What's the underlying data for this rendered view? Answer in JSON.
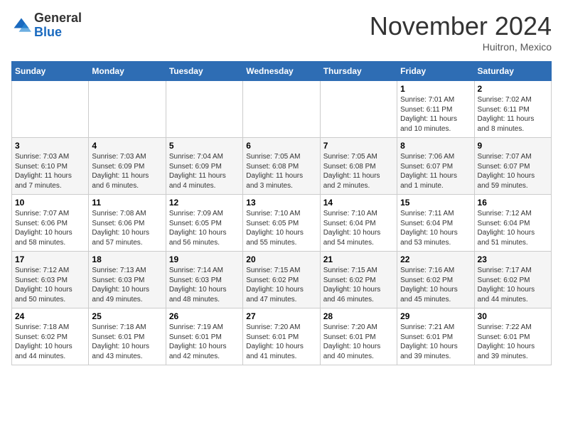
{
  "header": {
    "logo_line1": "General",
    "logo_line2": "Blue",
    "month_title": "November 2024",
    "location": "Huitron, Mexico"
  },
  "days_of_week": [
    "Sunday",
    "Monday",
    "Tuesday",
    "Wednesday",
    "Thursday",
    "Friday",
    "Saturday"
  ],
  "weeks": [
    [
      {
        "day": "",
        "info": ""
      },
      {
        "day": "",
        "info": ""
      },
      {
        "day": "",
        "info": ""
      },
      {
        "day": "",
        "info": ""
      },
      {
        "day": "",
        "info": ""
      },
      {
        "day": "1",
        "info": "Sunrise: 7:01 AM\nSunset: 6:11 PM\nDaylight: 11 hours\nand 10 minutes."
      },
      {
        "day": "2",
        "info": "Sunrise: 7:02 AM\nSunset: 6:11 PM\nDaylight: 11 hours\nand 8 minutes."
      }
    ],
    [
      {
        "day": "3",
        "info": "Sunrise: 7:03 AM\nSunset: 6:10 PM\nDaylight: 11 hours\nand 7 minutes."
      },
      {
        "day": "4",
        "info": "Sunrise: 7:03 AM\nSunset: 6:09 PM\nDaylight: 11 hours\nand 6 minutes."
      },
      {
        "day": "5",
        "info": "Sunrise: 7:04 AM\nSunset: 6:09 PM\nDaylight: 11 hours\nand 4 minutes."
      },
      {
        "day": "6",
        "info": "Sunrise: 7:05 AM\nSunset: 6:08 PM\nDaylight: 11 hours\nand 3 minutes."
      },
      {
        "day": "7",
        "info": "Sunrise: 7:05 AM\nSunset: 6:08 PM\nDaylight: 11 hours\nand 2 minutes."
      },
      {
        "day": "8",
        "info": "Sunrise: 7:06 AM\nSunset: 6:07 PM\nDaylight: 11 hours\nand 1 minute."
      },
      {
        "day": "9",
        "info": "Sunrise: 7:07 AM\nSunset: 6:07 PM\nDaylight: 10 hours\nand 59 minutes."
      }
    ],
    [
      {
        "day": "10",
        "info": "Sunrise: 7:07 AM\nSunset: 6:06 PM\nDaylight: 10 hours\nand 58 minutes."
      },
      {
        "day": "11",
        "info": "Sunrise: 7:08 AM\nSunset: 6:06 PM\nDaylight: 10 hours\nand 57 minutes."
      },
      {
        "day": "12",
        "info": "Sunrise: 7:09 AM\nSunset: 6:05 PM\nDaylight: 10 hours\nand 56 minutes."
      },
      {
        "day": "13",
        "info": "Sunrise: 7:10 AM\nSunset: 6:05 PM\nDaylight: 10 hours\nand 55 minutes."
      },
      {
        "day": "14",
        "info": "Sunrise: 7:10 AM\nSunset: 6:04 PM\nDaylight: 10 hours\nand 54 minutes."
      },
      {
        "day": "15",
        "info": "Sunrise: 7:11 AM\nSunset: 6:04 PM\nDaylight: 10 hours\nand 53 minutes."
      },
      {
        "day": "16",
        "info": "Sunrise: 7:12 AM\nSunset: 6:04 PM\nDaylight: 10 hours\nand 51 minutes."
      }
    ],
    [
      {
        "day": "17",
        "info": "Sunrise: 7:12 AM\nSunset: 6:03 PM\nDaylight: 10 hours\nand 50 minutes."
      },
      {
        "day": "18",
        "info": "Sunrise: 7:13 AM\nSunset: 6:03 PM\nDaylight: 10 hours\nand 49 minutes."
      },
      {
        "day": "19",
        "info": "Sunrise: 7:14 AM\nSunset: 6:03 PM\nDaylight: 10 hours\nand 48 minutes."
      },
      {
        "day": "20",
        "info": "Sunrise: 7:15 AM\nSunset: 6:02 PM\nDaylight: 10 hours\nand 47 minutes."
      },
      {
        "day": "21",
        "info": "Sunrise: 7:15 AM\nSunset: 6:02 PM\nDaylight: 10 hours\nand 46 minutes."
      },
      {
        "day": "22",
        "info": "Sunrise: 7:16 AM\nSunset: 6:02 PM\nDaylight: 10 hours\nand 45 minutes."
      },
      {
        "day": "23",
        "info": "Sunrise: 7:17 AM\nSunset: 6:02 PM\nDaylight: 10 hours\nand 44 minutes."
      }
    ],
    [
      {
        "day": "24",
        "info": "Sunrise: 7:18 AM\nSunset: 6:02 PM\nDaylight: 10 hours\nand 44 minutes."
      },
      {
        "day": "25",
        "info": "Sunrise: 7:18 AM\nSunset: 6:01 PM\nDaylight: 10 hours\nand 43 minutes."
      },
      {
        "day": "26",
        "info": "Sunrise: 7:19 AM\nSunset: 6:01 PM\nDaylight: 10 hours\nand 42 minutes."
      },
      {
        "day": "27",
        "info": "Sunrise: 7:20 AM\nSunset: 6:01 PM\nDaylight: 10 hours\nand 41 minutes."
      },
      {
        "day": "28",
        "info": "Sunrise: 7:20 AM\nSunset: 6:01 PM\nDaylight: 10 hours\nand 40 minutes."
      },
      {
        "day": "29",
        "info": "Sunrise: 7:21 AM\nSunset: 6:01 PM\nDaylight: 10 hours\nand 39 minutes."
      },
      {
        "day": "30",
        "info": "Sunrise: 7:22 AM\nSunset: 6:01 PM\nDaylight: 10 hours\nand 39 minutes."
      }
    ]
  ]
}
